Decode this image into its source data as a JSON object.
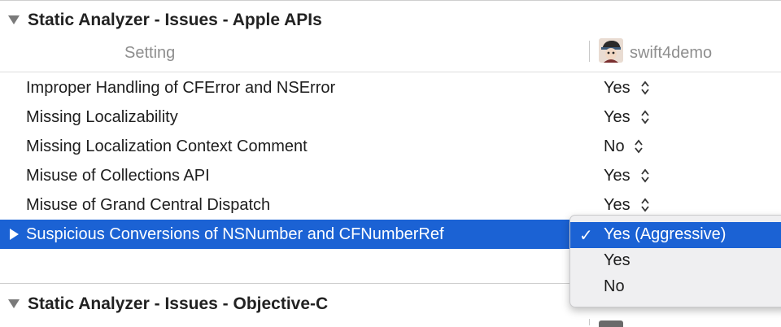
{
  "section1": {
    "title": "Static Analyzer - Issues - Apple APIs"
  },
  "columns": {
    "setting_label": "Setting",
    "target_name": "swift4demo"
  },
  "rows": [
    {
      "label": "Improper Handling of CFError and NSError",
      "value": "Yes"
    },
    {
      "label": "Missing Localizability",
      "value": "Yes"
    },
    {
      "label": "Missing Localization Context Comment",
      "value": "No"
    },
    {
      "label": "Misuse of Collections API",
      "value": "Yes"
    },
    {
      "label": "Misuse of Grand Central Dispatch",
      "value": "Yes"
    },
    {
      "label": "Suspicious Conversions of NSNumber and CFNumberRef",
      "value": "Yes (Aggressive)",
      "selected": true
    }
  ],
  "popup": {
    "options": [
      "Yes (Aggressive)",
      "Yes",
      "No"
    ],
    "selected": "Yes (Aggressive)",
    "check_glyph": "✓"
  },
  "section2": {
    "title": "Static Analyzer - Issues - Objective-C"
  },
  "colors": {
    "selection": "#1b62d4",
    "popup_bg": "#efeff1"
  }
}
